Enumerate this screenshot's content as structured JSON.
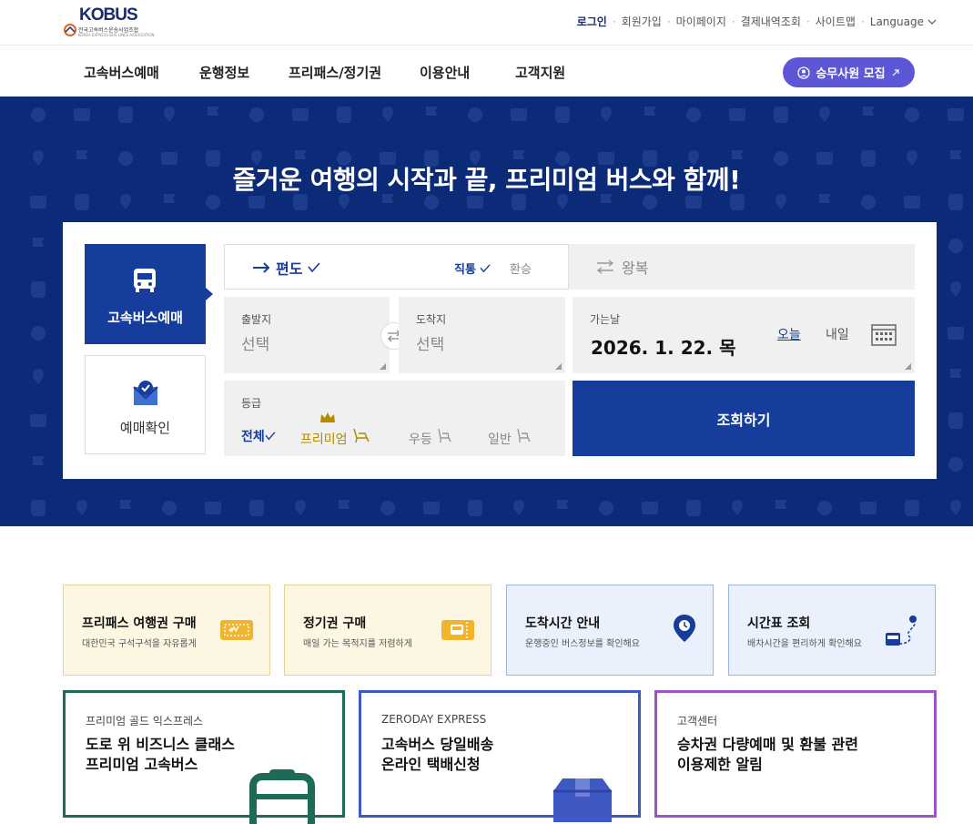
{
  "brand": {
    "logo_text": "KOBUS",
    "logo_subtitle": "전국고속버스운송사업조합",
    "logo_subtitle_en": "KOREA EXPRESS BUS LINES ASSOCIATION"
  },
  "utility_nav": {
    "items": [
      "로그인",
      "회원가입",
      "마이페이지",
      "결제내역조회",
      "사이트맵"
    ],
    "language_label": "Language"
  },
  "gnb": {
    "items": [
      "고속버스예매",
      "운행정보",
      "프리패스/정기권",
      "이용안내",
      "고객지원"
    ],
    "recruit_label": "승무사원 모집"
  },
  "hero": {
    "title": "즐거운 여행의 시작과 끝, 프리미엄 버스와 함께!"
  },
  "booking": {
    "tabs": {
      "bus_booking": "고속버스예매",
      "booking_check": "예매확인"
    },
    "trip": {
      "oneway": "편도",
      "direct": "직통",
      "transfer": "환승",
      "roundtrip": "왕복"
    },
    "departure": {
      "caption": "출발지",
      "value": "선택"
    },
    "arrival": {
      "caption": "도착지",
      "value": "선택"
    },
    "date": {
      "caption": "가는날",
      "value": "2026. 1. 22. 목",
      "today": "오늘",
      "tomorrow": "내일"
    },
    "grade": {
      "caption": "등급",
      "all": "전체",
      "premium": "프리미엄",
      "first": "우등",
      "normal": "일반"
    },
    "search_label": "조회하기"
  },
  "quick_cards": [
    {
      "title": "프리패스 여행권 구매",
      "subtitle": "대한민국 구석구석을 자유롭게",
      "icon": "ticket-icon",
      "bg": "#fdf6e3",
      "border": "#e8d29a"
    },
    {
      "title": "정기권 구매",
      "subtitle": "매일 가는 목적지를 저렴하게",
      "icon": "bus-ticket-icon",
      "bg": "#fdf6e3",
      "border": "#e8d29a"
    },
    {
      "title": "도착시간 안내",
      "subtitle": "운행중인 버스정보를 확인해요",
      "icon": "location-pin-icon",
      "bg": "#eaf1fc",
      "border": "#9bb6e6"
    },
    {
      "title": "시간표 조회",
      "subtitle": "배차시간을 편리하게 확인해요",
      "icon": "route-icon",
      "bg": "#eaf1fc",
      "border": "#9bb6e6"
    }
  ],
  "banner_cards": [
    {
      "category": "프리미엄 골드 익스프레스",
      "headline": "도로 위 비즈니스 클래스\n프리미엄 고속버스",
      "border": "#1d6b57"
    },
    {
      "category": "ZERODAY EXPRESS",
      "headline": "고속버스 당일배송\n온라인 택배신청",
      "border": "#3f59c4"
    },
    {
      "category": "고객센터",
      "headline": "승차권 다량예매 및 환불 관련\n이용제한 알림",
      "border": "#9b55c8"
    }
  ],
  "colors": {
    "primary": "#163d9c",
    "hero_bg": "#0b2a78",
    "recruit": "#5b57d6",
    "premium": "#b38a00"
  }
}
